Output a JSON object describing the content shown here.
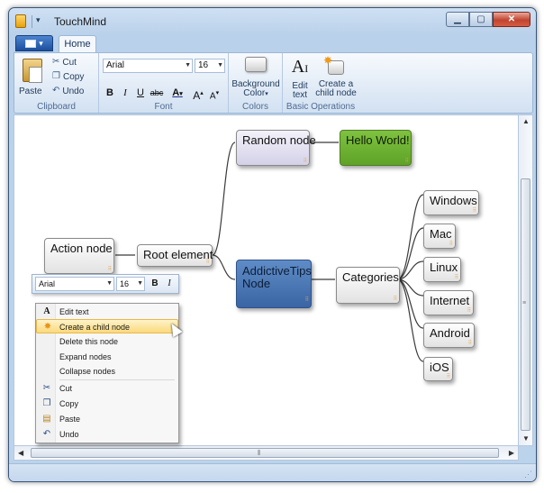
{
  "window": {
    "title": "TouchMind"
  },
  "titlebar": {
    "minimize": "▁",
    "maximize": "▢",
    "close": "✕"
  },
  "tabs": {
    "app_menu": "▾",
    "home": "Home"
  },
  "ribbon": {
    "clipboard": {
      "label": "Clipboard",
      "paste": "Paste",
      "cut": "Cut",
      "copy": "Copy",
      "undo": "Undo"
    },
    "font": {
      "label": "Font",
      "family": "Arial",
      "size": "16",
      "bold": "B",
      "italic": "I",
      "underline": "U",
      "strike": "abc",
      "color": "A",
      "grow": "A",
      "shrink": "A"
    },
    "colors": {
      "label": "Colors",
      "background_line1": "Background",
      "background_line2": "Color"
    },
    "basic": {
      "label": "Basic Operations",
      "edit_line1": "Edit",
      "edit_line2": "text",
      "create_line1": "Create a",
      "create_line2": "child node"
    }
  },
  "mindmap": {
    "nodes": {
      "action": "Action node",
      "root": "Root element",
      "random": "Random node",
      "hello": "Hello World!",
      "addictive_line1": "AddictiveTips",
      "addictive_line2": "Node",
      "categories": "Categories",
      "windows": "Windows",
      "mac": "Mac",
      "linux": "Linux",
      "internet": "Internet",
      "android": "Android",
      "ios": "iOS"
    },
    "hello_color": "#6db136",
    "addictive_color": "#4a78b6"
  },
  "minibar": {
    "family": "Arial",
    "size": "16",
    "bold": "B",
    "italic": "I"
  },
  "context_menu": {
    "items": [
      "Edit text",
      "Create a child node",
      "Delete this node",
      "Expand nodes",
      "Collapse nodes",
      "Cut",
      "Copy",
      "Paste",
      "Undo"
    ],
    "highlighted": "Create a child node"
  }
}
